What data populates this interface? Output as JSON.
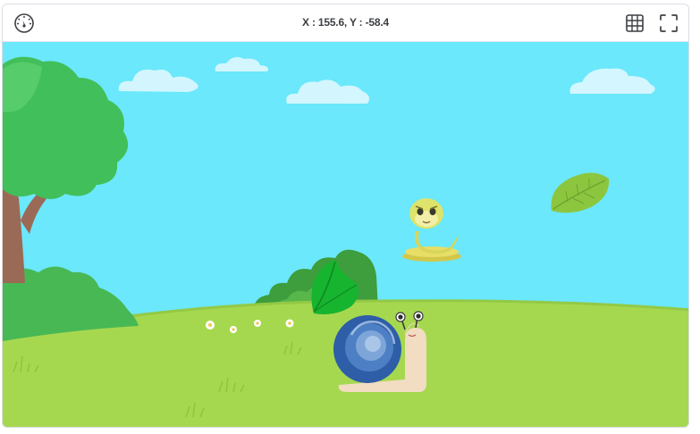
{
  "toolbar": {
    "speed_icon": "speedometer-icon",
    "coordinates_label": "X : 155.6, Y : -58.4",
    "grid_icon": "grid-icon",
    "fullscreen_icon": "fullscreen-icon"
  },
  "stage": {
    "backdrop": "park-meadow",
    "sprites": [
      {
        "name": "snail",
        "costume": "snail"
      },
      {
        "name": "snake",
        "costume": "snake"
      },
      {
        "name": "leaf-green",
        "costume": "leaf"
      },
      {
        "name": "leaf-light",
        "costume": "leaf"
      }
    ]
  },
  "colors": {
    "sky": "#6be8fb",
    "grass": "#a6d84f",
    "tree_foliage": "#41bf5a",
    "snail_shell": "#2e5ea8"
  }
}
